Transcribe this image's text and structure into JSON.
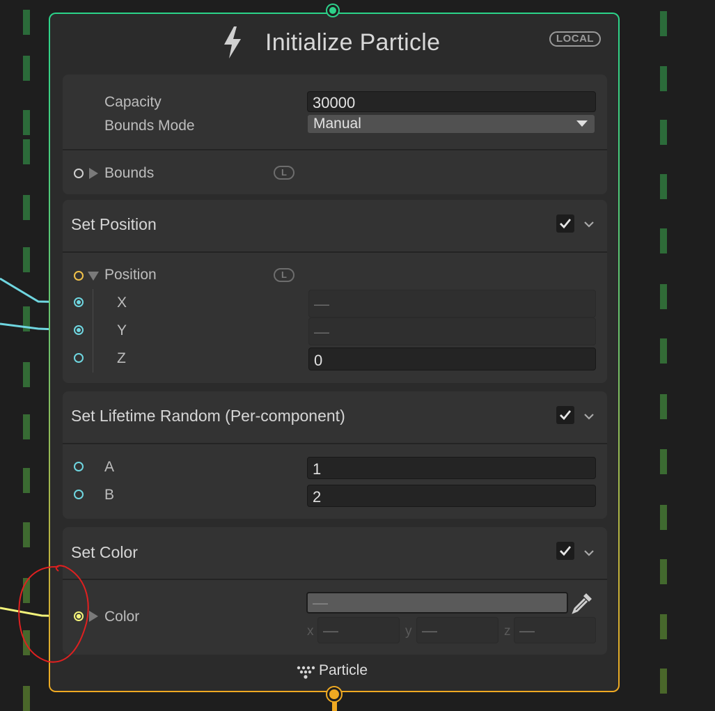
{
  "node": {
    "title": "Initialize Particle",
    "space_badge": "LOCAL",
    "footer_label": "Particle",
    "accent_top": "#2ed18a",
    "accent_bottom": "#f0aa22"
  },
  "settings": {
    "capacity_label": "Capacity",
    "capacity_value": "30000",
    "bounds_mode_label": "Bounds Mode",
    "bounds_mode_value": "Manual",
    "bounds_label": "Bounds",
    "bounds_space_badge": "L"
  },
  "blocks": {
    "set_position": {
      "title": "Set Position",
      "enabled": true,
      "property_label": "Position",
      "space_badge": "L",
      "x_label": "X",
      "x_value": "—",
      "y_label": "Y",
      "y_value": "—",
      "z_label": "Z",
      "z_value": "0"
    },
    "set_lifetime": {
      "title": "Set Lifetime Random (Per-component)",
      "enabled": true,
      "a_label": "A",
      "a_value": "1",
      "b_label": "B",
      "b_value": "2"
    },
    "set_color": {
      "title": "Set Color",
      "enabled": true,
      "property_label": "Color",
      "color_value": "—",
      "x_label": "x",
      "x_value": "—",
      "y_label": "y",
      "y_value": "—",
      "z_label": "z",
      "z_value": "—"
    }
  },
  "icons": {
    "header": "lightning-icon",
    "eyedropper": "eyedropper-icon",
    "footer": "particle-icon",
    "checkbox": "checkmark-icon",
    "collapse": "chevron-down-icon"
  }
}
